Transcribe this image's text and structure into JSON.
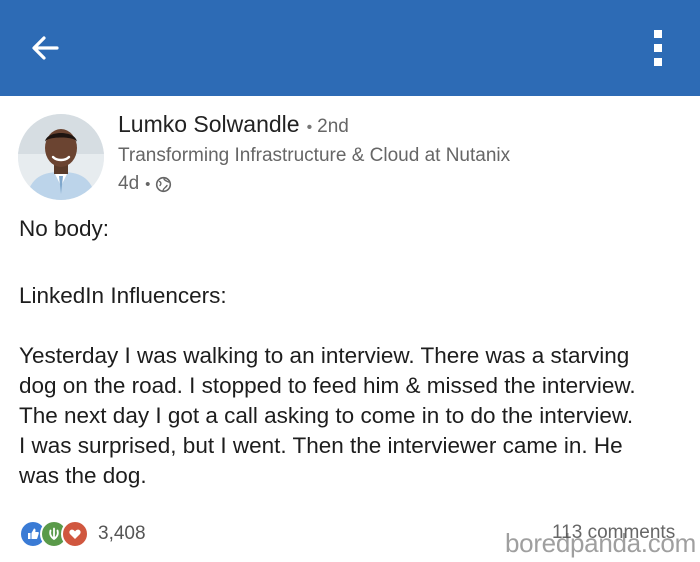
{
  "header": {
    "background_color": "#2d6bb5",
    "back_icon": "arrow-left-icon",
    "menu_icon": "more-vertical-icon"
  },
  "post": {
    "author": {
      "name": "Lumko Solwandle",
      "connection_degree": "2nd",
      "headline": "Transforming Infrastructure & Cloud at Nutanix",
      "time_ago": "4d",
      "visibility_icon": "globe-icon"
    },
    "body": {
      "p1": "No body:",
      "p2": "LinkedIn Influencers:",
      "p3_lines": [
        "Yesterday I was walking to an interview. There was a starving",
        "dog on the road. I stopped to feed him & missed the interview.",
        "The next day I got a call asking to come in to do the interview.",
        "I was surprised, but I went. Then the interviewer came in. He",
        "was the dog."
      ]
    },
    "social": {
      "reaction_icons": [
        "like-icon",
        "celebrate-icon",
        "love-icon"
      ],
      "reaction_count": "3,408",
      "comments": "113 comments"
    }
  },
  "watermark": "boredpanda.com"
}
